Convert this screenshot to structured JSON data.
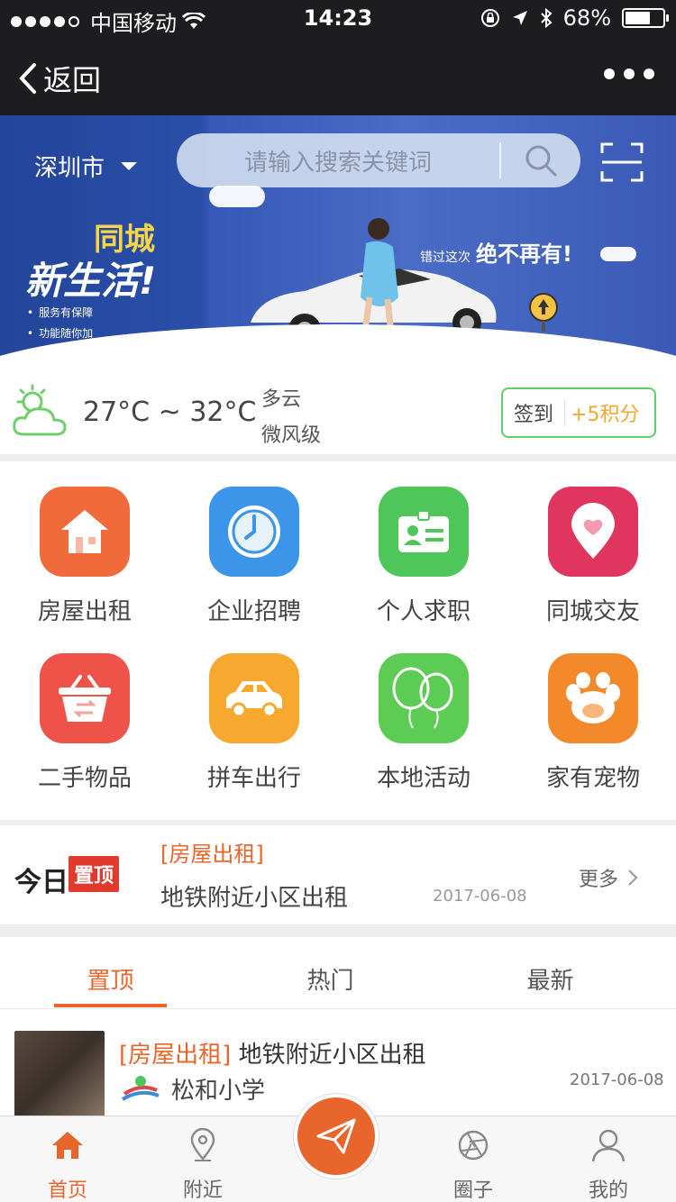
{
  "status_bar": {
    "carrier": "中国移动",
    "time": "14:23",
    "battery": "68%",
    "battery_level": 0.68
  },
  "nav": {
    "back_label": "返回"
  },
  "banner": {
    "city": "深圳市",
    "search_placeholder": "请输入搜索关键词",
    "promo_line1": "同城",
    "promo_line2": "新生活!",
    "promo_points": [
      "服务有保障",
      "功能随你加"
    ],
    "promo_right_small": "错过这次",
    "promo_right_big": "绝不再有!"
  },
  "weather": {
    "temp_range": "27°C ~ 32°C",
    "condition": "多云",
    "wind": "微风级",
    "signin_label": "签到",
    "signin_points": "+5积分"
  },
  "categories": [
    {
      "label": "房屋出租",
      "color": "#f06a3b",
      "icon": "house-icon"
    },
    {
      "label": "企业招聘",
      "color": "#3d95ea",
      "icon": "clock-icon"
    },
    {
      "label": "个人求职",
      "color": "#4ec65a",
      "icon": "id-card-icon"
    },
    {
      "label": "同城交友",
      "color": "#e0355f",
      "icon": "heart-pin-icon"
    },
    {
      "label": "二手物品",
      "color": "#ee5249",
      "icon": "basket-icon"
    },
    {
      "label": "拼车出行",
      "color": "#f6a92e",
      "icon": "car-icon"
    },
    {
      "label": "本地活动",
      "color": "#5ccc54",
      "icon": "balloon-icon"
    },
    {
      "label": "家有宠物",
      "color": "#f3892b",
      "icon": "paw-icon"
    }
  ],
  "today": {
    "prefix": "今日",
    "badge": "置顶",
    "category": "[房屋出租]",
    "title": "地铁附近小区出租",
    "date": "2017-06-08",
    "more": "更多"
  },
  "tabs": [
    {
      "label": "置顶"
    },
    {
      "label": "热门"
    },
    {
      "label": "最新"
    }
  ],
  "list": [
    {
      "tag": "[房屋出租]",
      "title": "地铁附近小区出租",
      "school": "松和小学",
      "date": "2017-06-08"
    }
  ],
  "tabbar": [
    {
      "label": "首页"
    },
    {
      "label": "附近"
    },
    {
      "label": "圈子"
    },
    {
      "label": "我的"
    }
  ]
}
